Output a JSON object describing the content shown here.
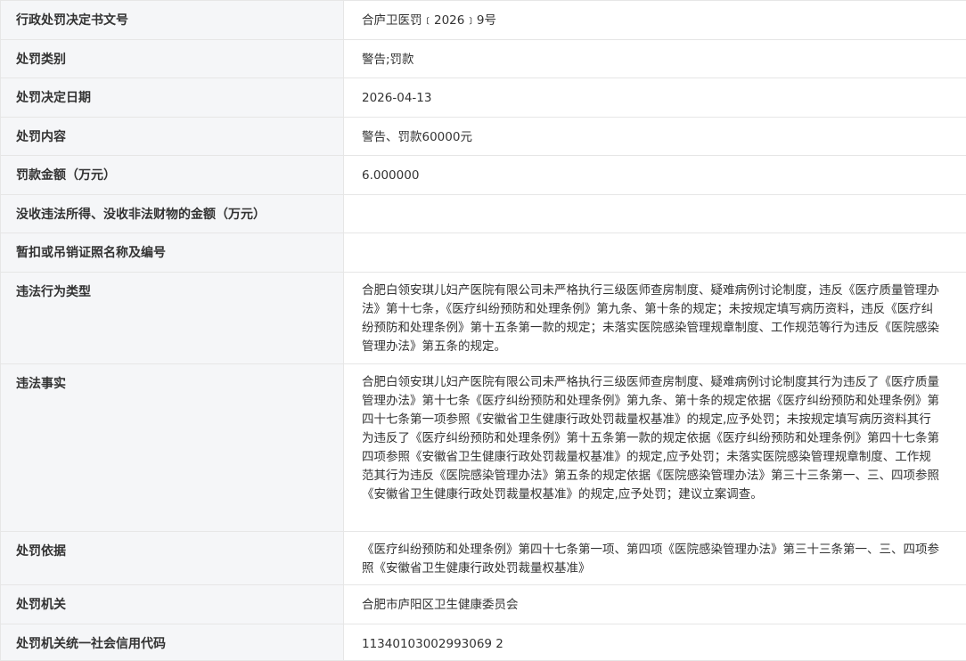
{
  "rows": [
    {
      "label": "行政处罚决定书文号",
      "value": "合庐卫医罚﹝2026﹞9号"
    },
    {
      "label": "处罚类别",
      "value": "警告;罚款"
    },
    {
      "label": "处罚决定日期",
      "value": "2026-04-13"
    },
    {
      "label": "处罚内容",
      "value": "警告、罚款60000元"
    },
    {
      "label": "罚款金额（万元）",
      "value": "6.000000"
    },
    {
      "label": "没收违法所得、没收非法财物的金额（万元）",
      "value": ""
    },
    {
      "label": "暂扣或吊销证照名称及编号",
      "value": ""
    },
    {
      "label": "违法行为类型",
      "value": "合肥白领安琪儿妇产医院有限公司未严格执行三级医师查房制度、疑难病例讨论制度，违反《医疗质量管理办法》第十七条，《医疗纠纷预防和处理条例》第九条、第十条的规定；未按规定填写病历资料，违反《医疗纠纷预防和处理条例》第十五条第一款的规定；未落实医院感染管理规章制度、工作规范等行为违反《医院感染管理办法》第五条的规定。"
    },
    {
      "label": "违法事实",
      "value": "合肥白领安琪儿妇产医院有限公司未严格执行三级医师查房制度、疑难病例讨论制度其行为违反了《医疗质量管理办法》第十七条《医疗纠纷预防和处理条例》第九条、第十条的规定依据《医疗纠纷预防和处理条例》第四十七条第一项参照《安徽省卫生健康行政处罚裁量权基准》的规定,应予处罚；未按规定填写病历资料其行为违反了《医疗纠纷预防和处理条例》第十五条第一款的规定依据《医疗纠纷预防和处理条例》第四十七条第四项参照《安徽省卫生健康行政处罚裁量权基准》的规定,应予处罚；未落实医院感染管理规章制度、工作规范其行为违反《医院感染管理办法》第五条的规定依据《医院感染管理办法》第三十三条第一、三、四项参照《安徽省卫生健康行政处罚裁量权基准》的规定,应予处罚；建议立案调查。"
    },
    {
      "label": "处罚依据",
      "value": "《医疗纠纷预防和处理条例》第四十七条第一项、第四项《医院感染管理办法》第三十三条第一、三、四项参照《安徽省卫生健康行政处罚裁量权基准》"
    },
    {
      "label": "处罚机关",
      "value": "合肥市庐阳区卫生健康委员会"
    },
    {
      "label": "处罚机关统一社会信用代码",
      "value": "11340103002993069 2"
    }
  ]
}
